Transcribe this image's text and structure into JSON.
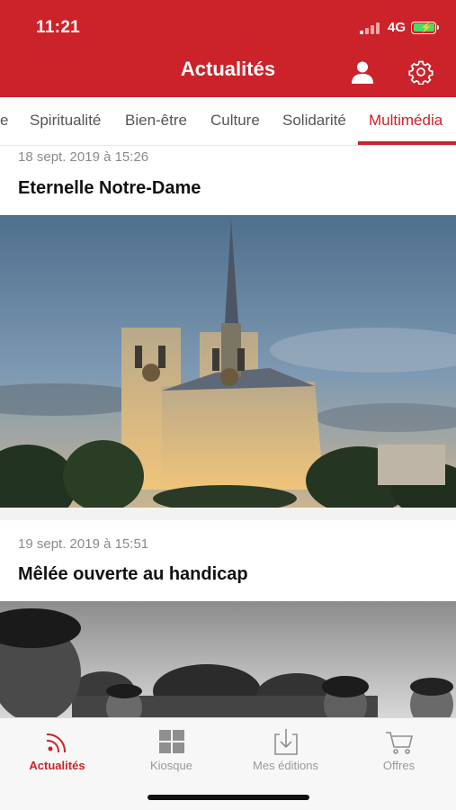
{
  "status_bar": {
    "time": "11:21",
    "network": "4G"
  },
  "header": {
    "title": "Actualités"
  },
  "tabs": [
    {
      "label": "e"
    },
    {
      "label": "Spiritualité"
    },
    {
      "label": "Bien-être"
    },
    {
      "label": "Culture"
    },
    {
      "label": "Solidarité"
    },
    {
      "label": "Multimédia",
      "active": true
    }
  ],
  "articles": [
    {
      "date": "18 sept. 2019 à 15:26",
      "title": "Eternelle Notre-Dame"
    },
    {
      "date": "19 sept. 2019 à 15:51",
      "title": "Mêlée ouverte au handicap"
    }
  ],
  "bottom_nav": [
    {
      "label": "Actualités",
      "icon": "rss-icon",
      "active": true
    },
    {
      "label": "Kiosque",
      "icon": "kiosk-icon"
    },
    {
      "label": "Mes éditions",
      "icon": "download-icon"
    },
    {
      "label": "Offres",
      "icon": "cart-icon"
    }
  ],
  "colors": {
    "brand": "#cc2229",
    "inactive": "#999999"
  }
}
